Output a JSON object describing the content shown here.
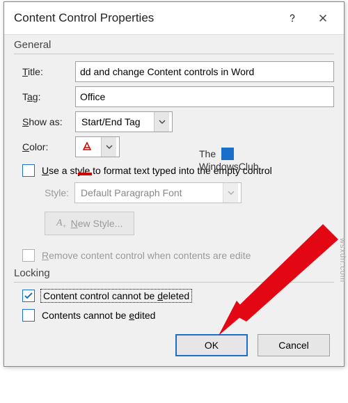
{
  "window": {
    "title": "Content Control Properties"
  },
  "general": {
    "heading": "General",
    "title_label": "Title:",
    "title_value": "dd and change Content controls in Word",
    "tag_label": "Tag:",
    "tag_value": "Office",
    "showas_label": "Show as:",
    "showas_value": "Start/End Tag",
    "color_label": "Color:",
    "use_style_label": "Use a style to format text typed into the empty control",
    "style_label": "Style:",
    "style_value": "Default Paragraph Font",
    "new_style_label": "New Style...",
    "remove_label": "Remove content control when contents are edite"
  },
  "locking": {
    "heading": "Locking",
    "cannot_delete_label": "Content control cannot be deleted",
    "cannot_edit_label": "Contents cannot be edited"
  },
  "buttons": {
    "ok": "OK",
    "cancel": "Cancel"
  },
  "watermark": {
    "line1": "The",
    "line2": "WindowsClub",
    "side": "wsxdn.com"
  }
}
